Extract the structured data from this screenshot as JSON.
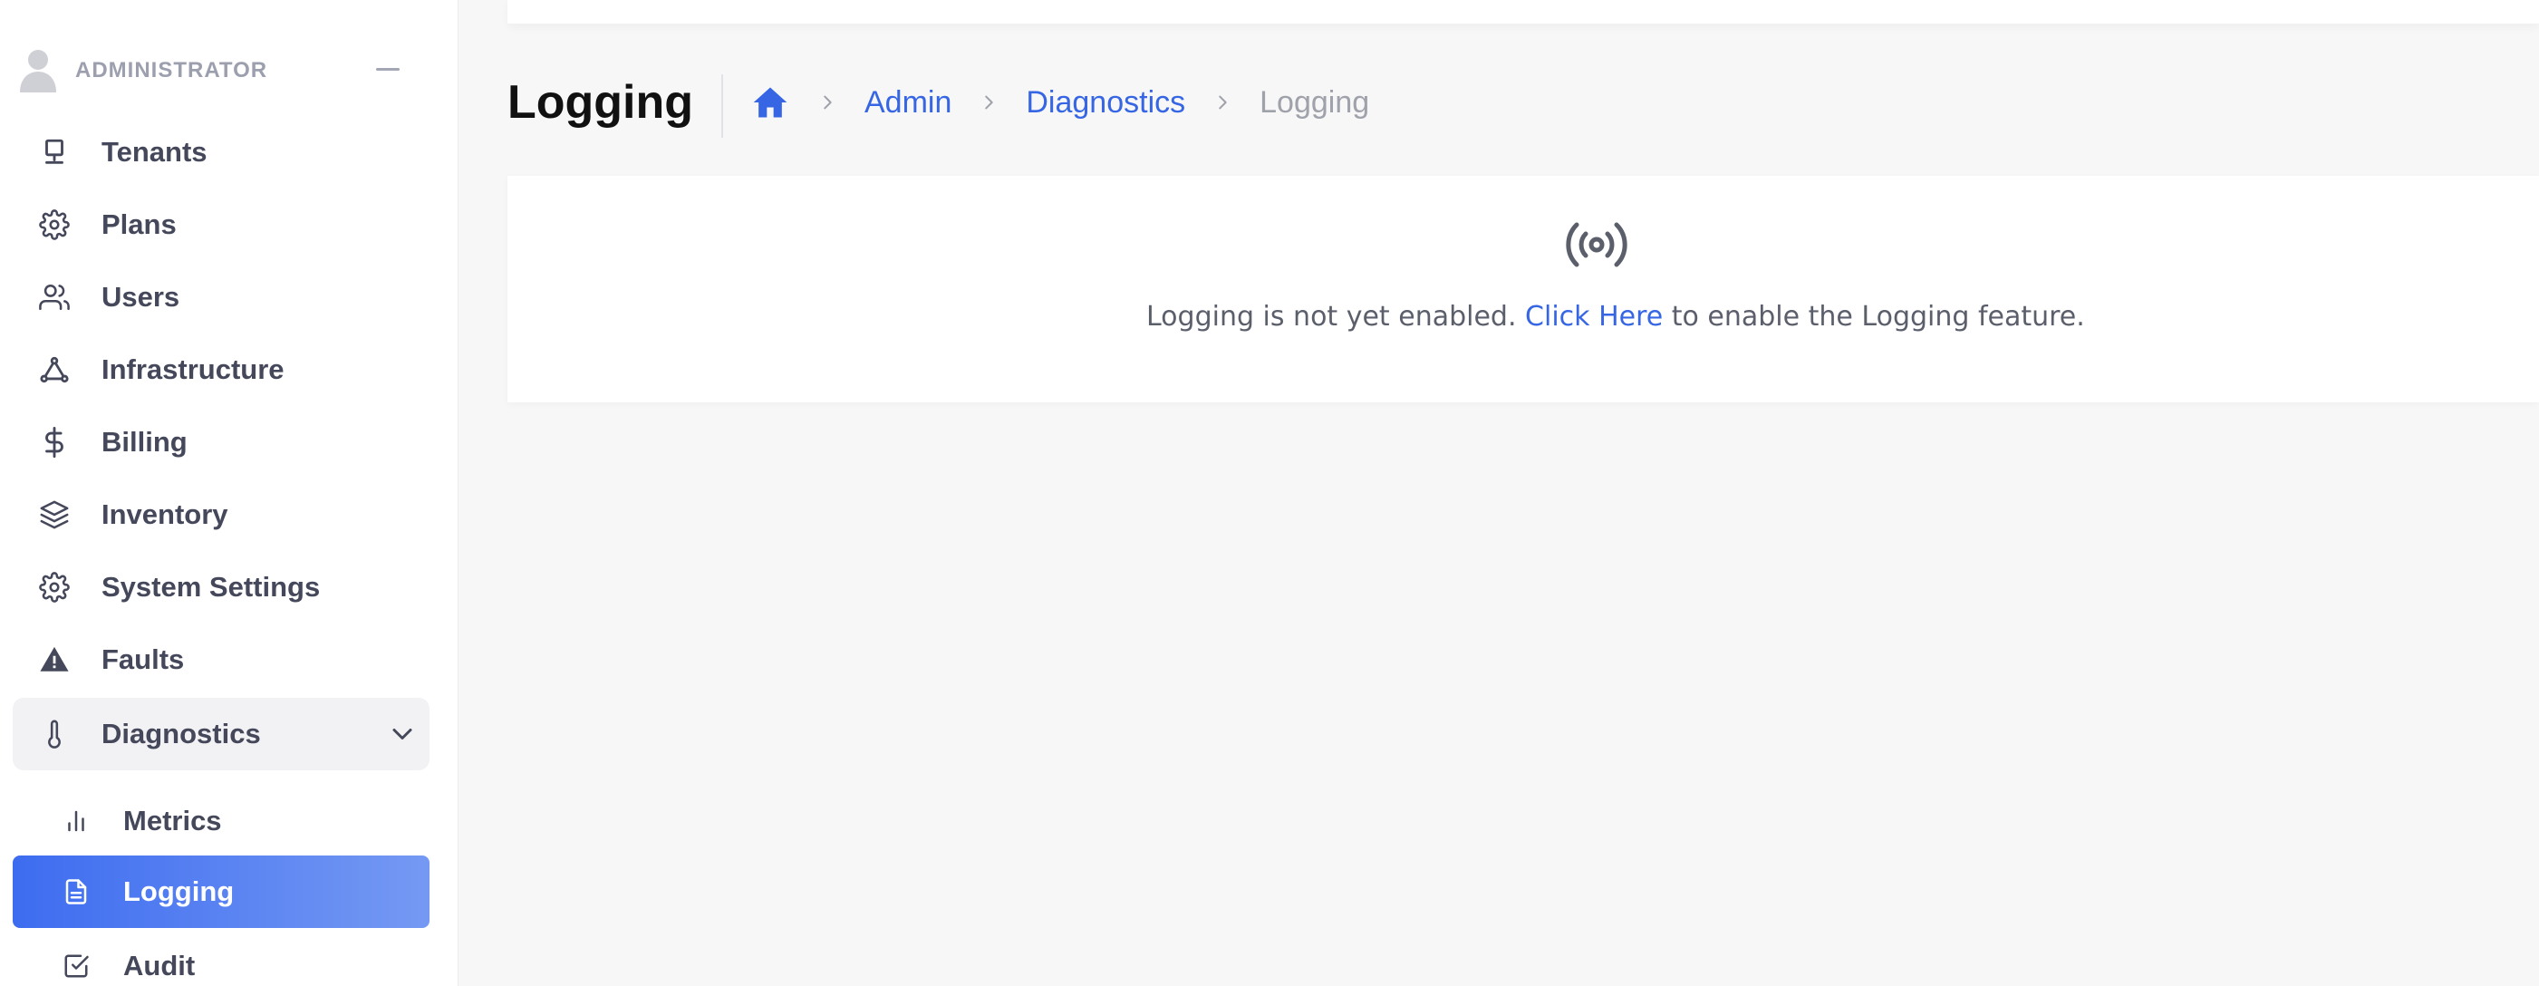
{
  "sidebar": {
    "role": "ADMINISTRATOR",
    "items": [
      {
        "label": "Tenants",
        "icon": "monitor-icon"
      },
      {
        "label": "Plans",
        "icon": "gear-icon"
      },
      {
        "label": "Users",
        "icon": "users-icon"
      },
      {
        "label": "Infrastructure",
        "icon": "network-icon"
      },
      {
        "label": "Billing",
        "icon": "dollar-icon"
      },
      {
        "label": "Inventory",
        "icon": "layers-icon"
      },
      {
        "label": "System Settings",
        "icon": "gear-icon"
      },
      {
        "label": "Faults",
        "icon": "warning-icon"
      },
      {
        "label": "Diagnostics",
        "icon": "thermometer-icon",
        "expanded": true
      }
    ],
    "subitems": [
      {
        "label": "Metrics",
        "icon": "bar-chart-icon"
      },
      {
        "label": "Logging",
        "icon": "document-icon",
        "active": true
      },
      {
        "label": "Audit",
        "icon": "checkbox-icon"
      }
    ]
  },
  "header": {
    "title": "Logging",
    "breadcrumb": {
      "home_icon": "home-icon",
      "links": [
        "Admin",
        "Diagnostics"
      ],
      "current": "Logging"
    }
  },
  "card": {
    "icon": "broadcast-icon",
    "message_before": "Logging is not yet enabled. ",
    "link_text": "Click Here",
    "message_after": " to enable the Logging feature."
  },
  "colors": {
    "accent": "#3d6cf0",
    "link": "#3666e3",
    "background": "#f7f7f7"
  }
}
